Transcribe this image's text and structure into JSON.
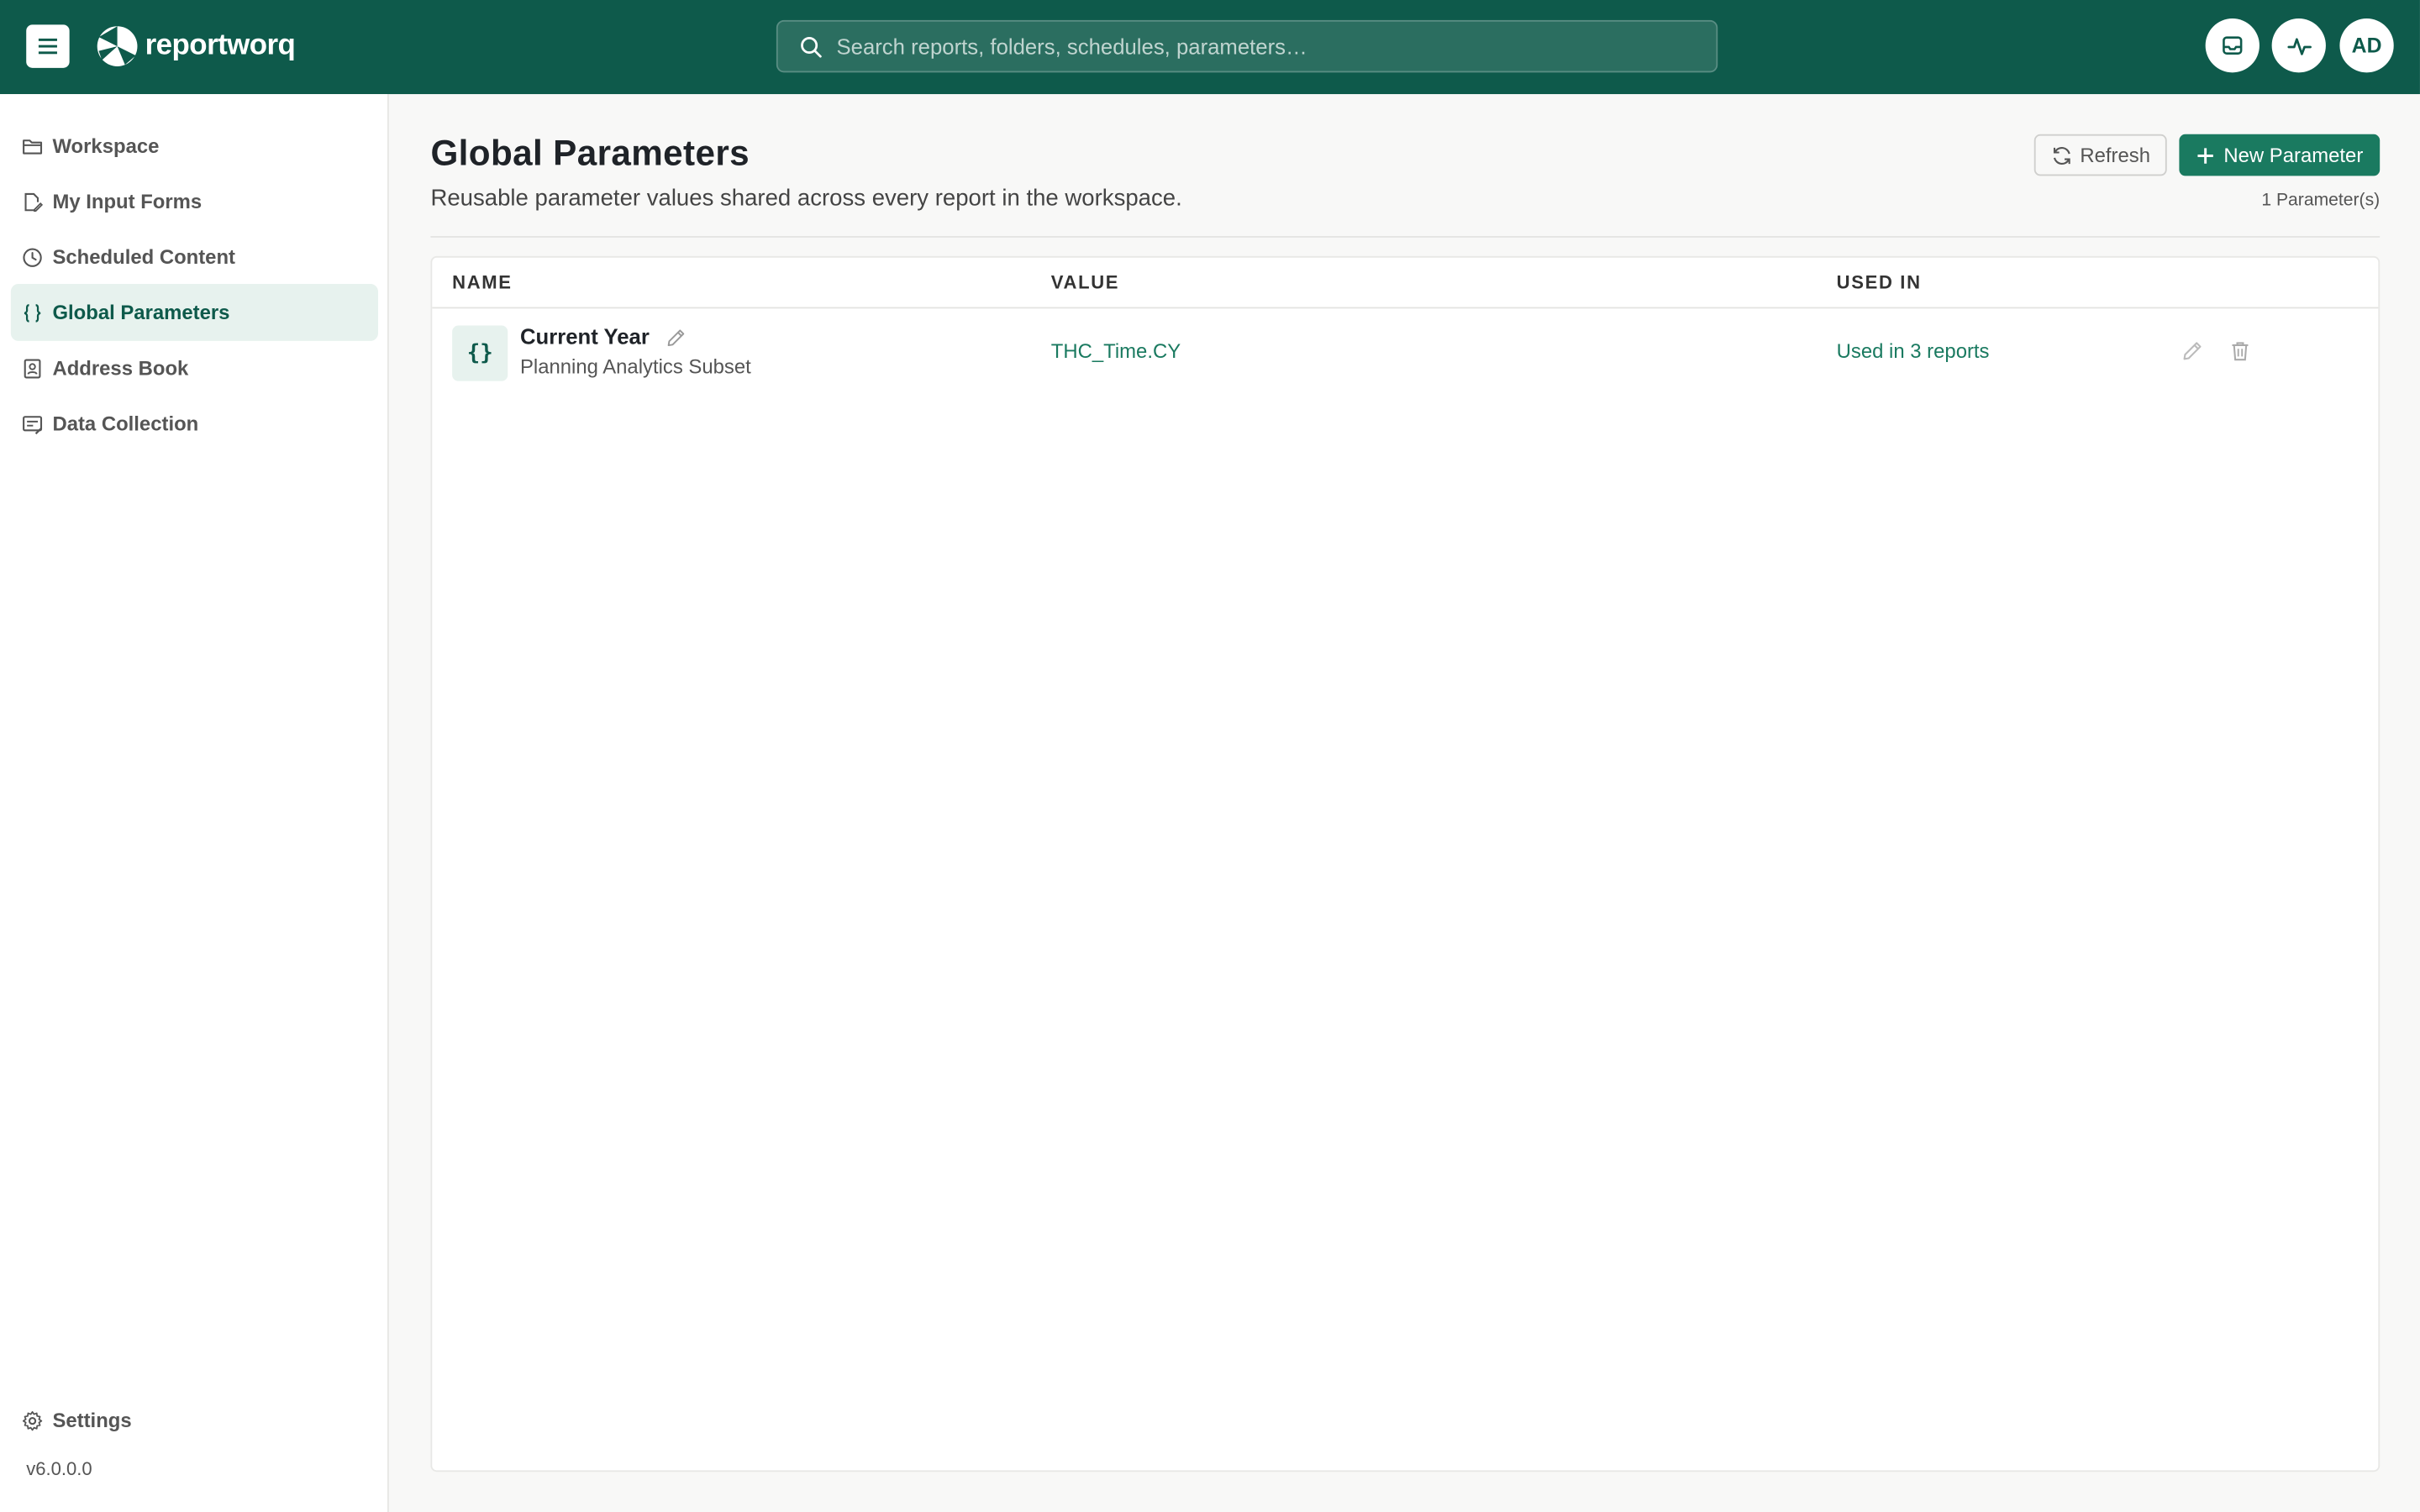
{
  "app": {
    "name": "reportworq"
  },
  "search": {
    "placeholder": "Search reports, folders, schedules, parameters…"
  },
  "header": {
    "avatar_initials": "AD"
  },
  "sidebar": {
    "items": [
      {
        "label": "Workspace",
        "icon": "folder-icon"
      },
      {
        "label": "My Input Forms",
        "icon": "form-edit-icon"
      },
      {
        "label": "Scheduled Content",
        "icon": "clock-icon"
      },
      {
        "label": "Global Parameters",
        "icon": "braces-icon",
        "active": true
      },
      {
        "label": "Address Book",
        "icon": "address-book-icon"
      },
      {
        "label": "Data Collection",
        "icon": "data-collection-icon"
      }
    ],
    "settings_label": "Settings",
    "version": "v6.0.0.0"
  },
  "page": {
    "title": "Global Parameters",
    "subtitle": "Reusable parameter values shared across every report in the workspace.",
    "refresh_label": "Refresh",
    "new_label": "New Parameter",
    "count_text": "1 Parameter(s)"
  },
  "table": {
    "columns": [
      "NAME",
      "VALUE",
      "USED IN"
    ],
    "rows": [
      {
        "badge": "{}",
        "name": "Current Year",
        "type": "Planning Analytics Subset",
        "value": "THC_Time.CY",
        "used_in": "Used in 3 reports"
      }
    ]
  },
  "colors": {
    "brand": "#0e5a4b",
    "accent": "#1a7a60",
    "active_bg": "#e7f2ee"
  }
}
